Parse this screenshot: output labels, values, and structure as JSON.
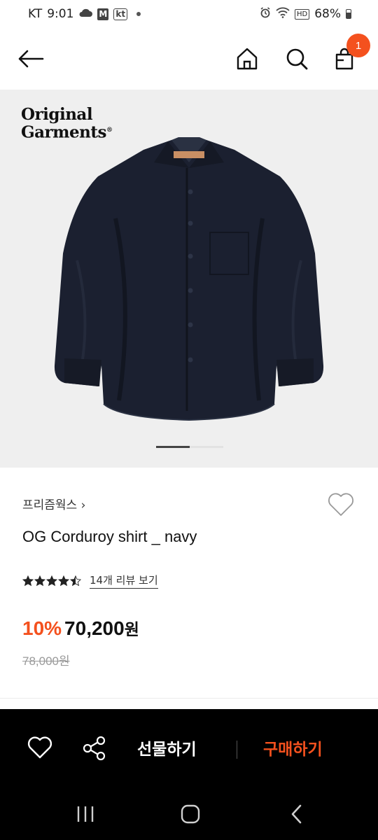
{
  "status_bar": {
    "carrier": "KT",
    "time": "9:01",
    "icons": [
      "cloud-icon",
      "gmail-m-icon",
      "kt-app-icon",
      "notification-dot-icon",
      "alarm-icon",
      "wifi-icon",
      "hd-voice-icon",
      "battery-icon"
    ],
    "m_label": "M",
    "kt_label": "kt",
    "hd_label": "HD",
    "battery": "68%"
  },
  "header": {
    "icons": [
      "back-arrow-icon",
      "home-icon",
      "search-icon",
      "shopping-bag-icon"
    ],
    "cart_count": "1"
  },
  "product_image": {
    "logo_line1": "Original",
    "logo_line2": "Garments",
    "logo_mark": "®",
    "page_count": 2,
    "active_page": 1
  },
  "product": {
    "brand": "프리즘웍스",
    "brand_chevron": "›",
    "name": "OG Corduroy shirt _ navy",
    "rating": 4.5,
    "rating_max": 5,
    "review_link": "14개 리뷰 보기",
    "discount": "10%",
    "price": "70,200",
    "price_unit": "원",
    "original_price": "78,000원"
  },
  "action_bar": {
    "icons": [
      "heart-icon",
      "share-icon"
    ],
    "gift_label": "선물하기",
    "buy_label": "구매하기"
  },
  "nav_bar": {
    "icons": [
      "recent-apps-icon",
      "home-circle-icon",
      "back-chevron-icon"
    ]
  },
  "colors": {
    "accent": "#f4511e",
    "bar_background": "#000000",
    "image_background": "#efefef",
    "shirt": "#1b2030"
  }
}
